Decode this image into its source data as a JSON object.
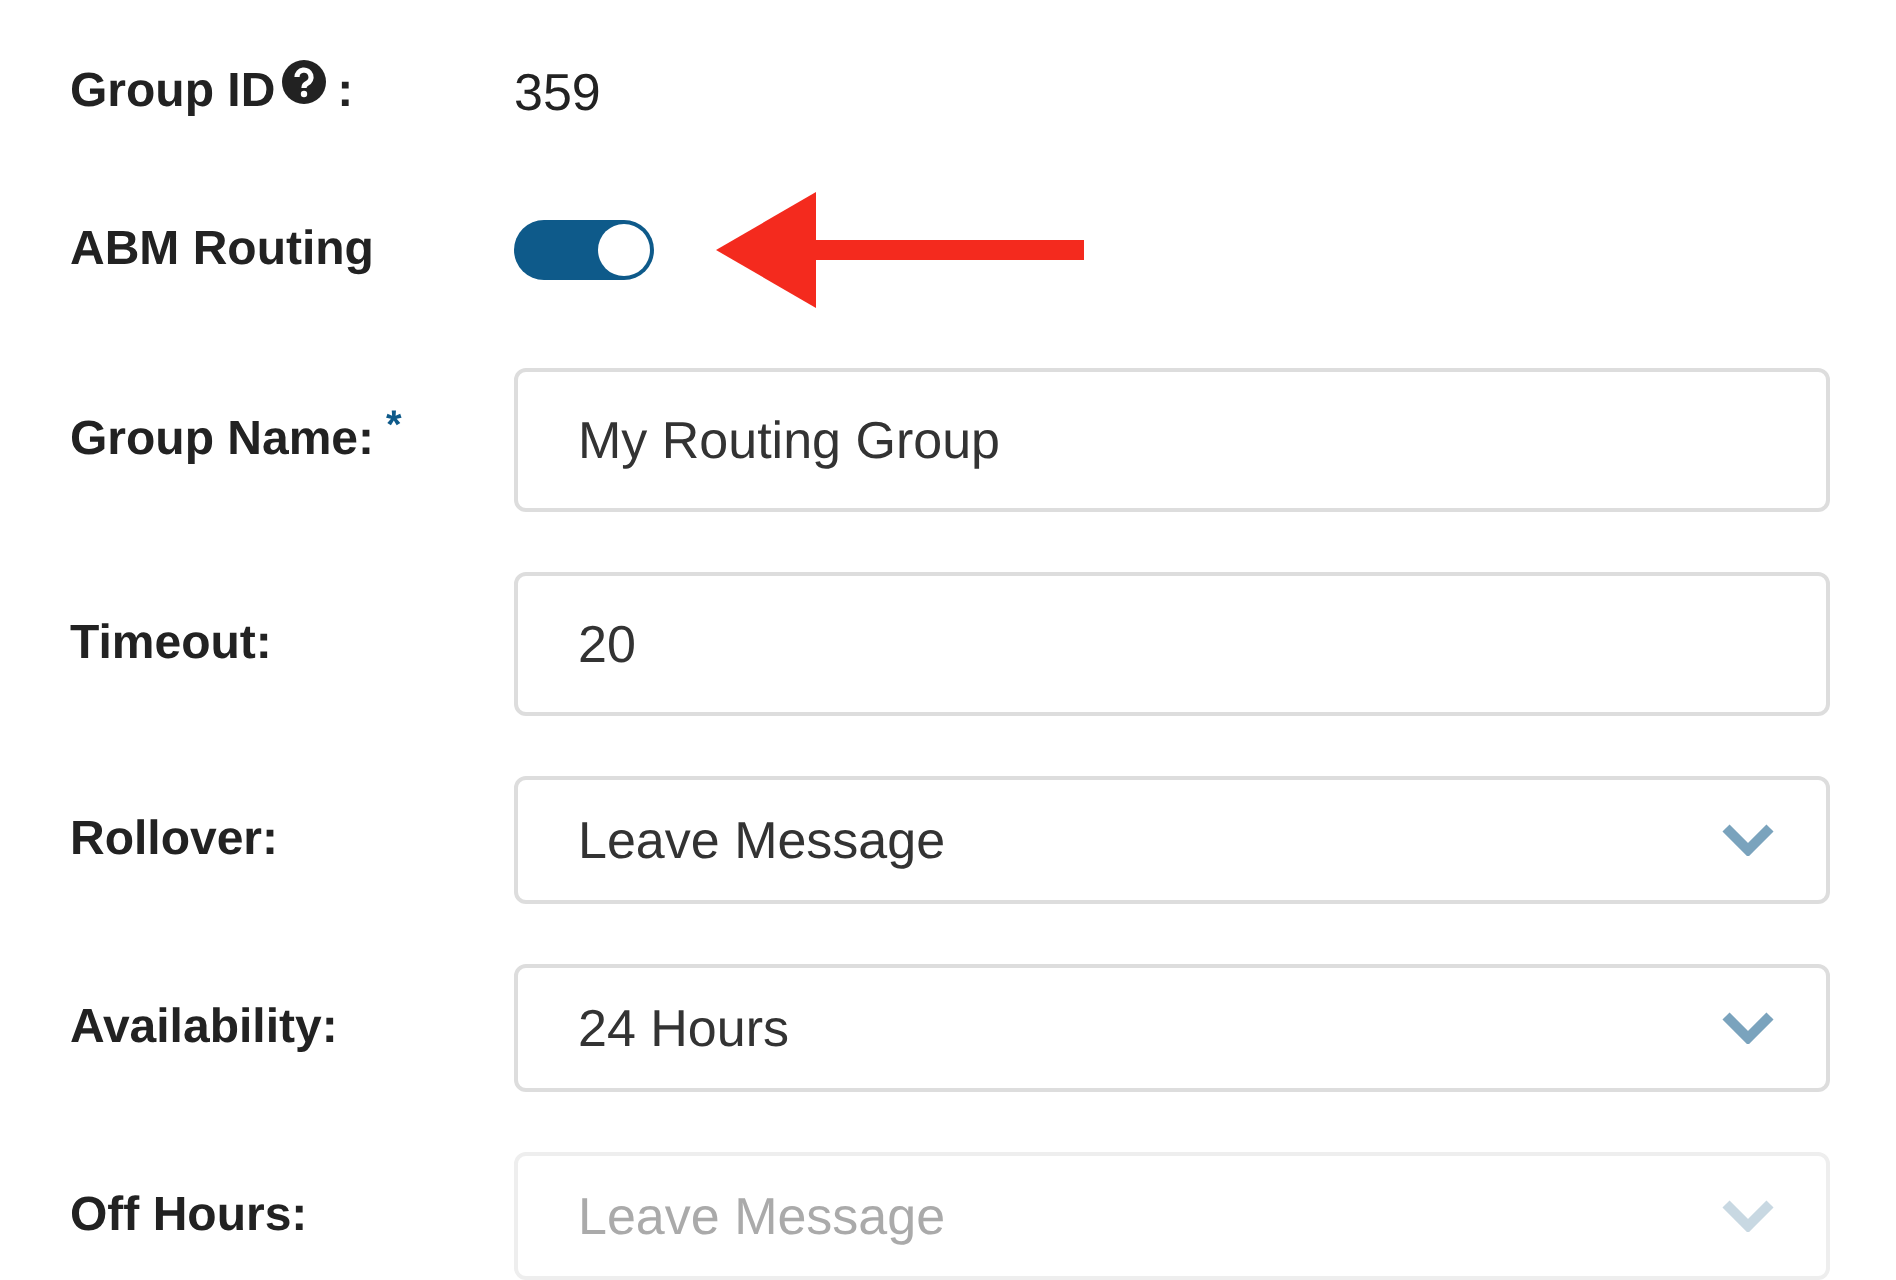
{
  "rows": [
    {
      "kind": "static",
      "label": "Group ID",
      "help": true,
      "colon": ":",
      "value": "359"
    },
    {
      "kind": "toggle",
      "label": "ABM Routing",
      "on": true
    },
    {
      "kind": "text",
      "label": "Group Name:",
      "mark": "*",
      "value": "My Routing Group"
    },
    {
      "kind": "text",
      "label": "Timeout:",
      "value": "20"
    },
    {
      "kind": "select",
      "label": "Rollover:",
      "disabled": false,
      "value": "Leave Message"
    },
    {
      "kind": "select",
      "label": "Availability:",
      "disabled": false,
      "value": "24 Hours"
    },
    {
      "kind": "select",
      "label": "Off Hours:",
      "disabled": true,
      "value": "Leave Message"
    }
  ]
}
